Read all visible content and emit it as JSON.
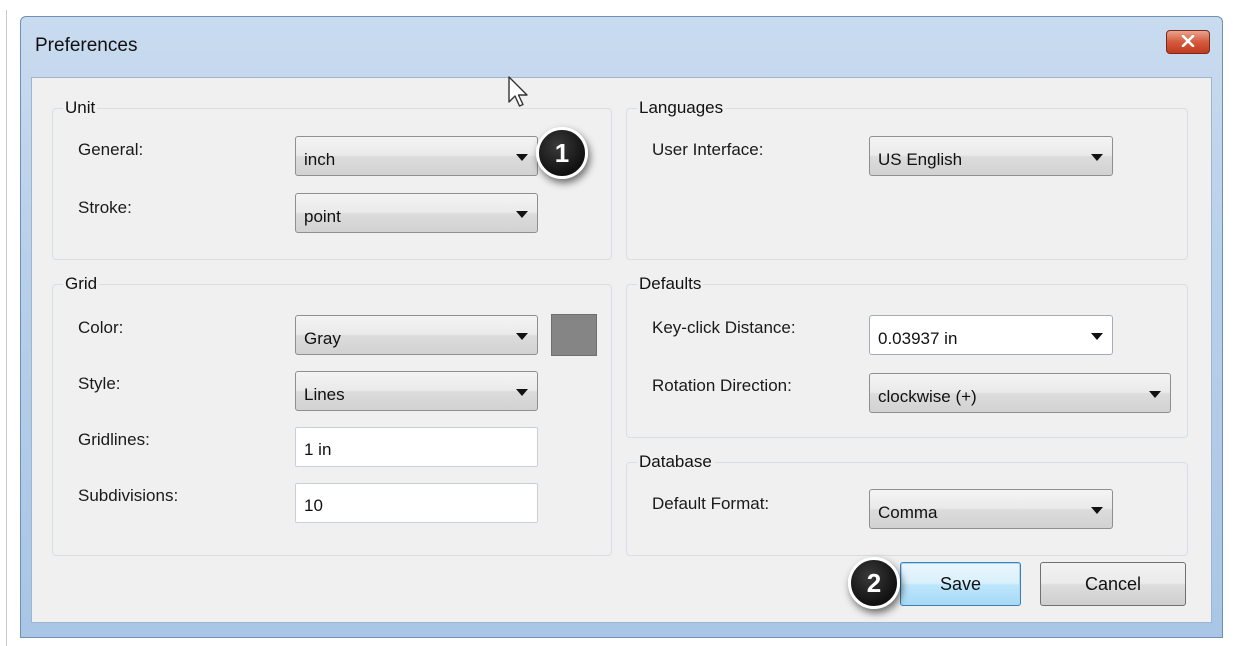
{
  "window": {
    "title": "Preferences",
    "close_icon": "close-x-icon"
  },
  "unit": {
    "legend": "Unit",
    "general": {
      "label": "General:",
      "value": "inch"
    },
    "stroke": {
      "label": "Stroke:",
      "value": "point"
    }
  },
  "languages": {
    "legend": "Languages",
    "ui": {
      "label": "User Interface:",
      "value": "US English"
    }
  },
  "grid": {
    "legend": "Grid",
    "color": {
      "label": "Color:",
      "value": "Gray",
      "swatch_hex": "#858585"
    },
    "style": {
      "label": "Style:",
      "value": "Lines"
    },
    "gridlines": {
      "label": "Gridlines:",
      "value": "1 in"
    },
    "subdivisions": {
      "label": "Subdivisions:",
      "value": "10"
    }
  },
  "defaults": {
    "legend": "Defaults",
    "keyclick": {
      "label": "Key-click Distance:",
      "value": "0.03937 in"
    },
    "rotation": {
      "label": "Rotation Direction:",
      "value": "clockwise (+)"
    }
  },
  "database": {
    "legend": "Database",
    "format": {
      "label": "Default Format:",
      "value": "Comma"
    }
  },
  "buttons": {
    "save": "Save",
    "cancel": "Cancel"
  },
  "callouts": {
    "one": "1",
    "two": "2"
  }
}
